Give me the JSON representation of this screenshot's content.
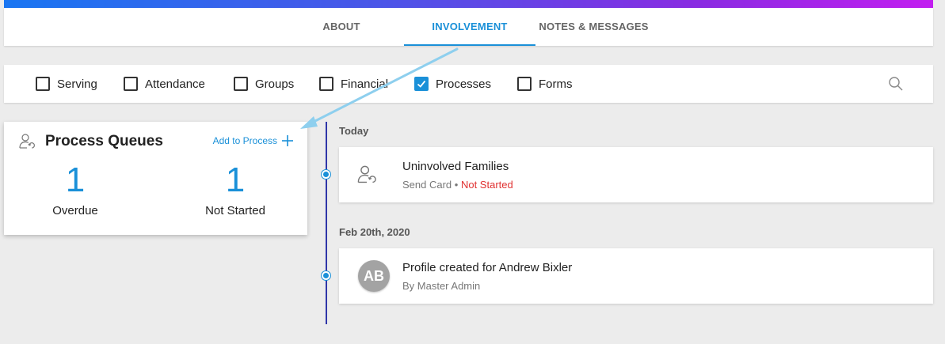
{
  "tabs": [
    {
      "label": "ABOUT",
      "active": false
    },
    {
      "label": "INVOLVEMENT",
      "active": true
    },
    {
      "label": "NOTES & MESSAGES",
      "active": false
    }
  ],
  "filters": [
    {
      "label": "Serving",
      "checked": false
    },
    {
      "label": "Attendance",
      "checked": false
    },
    {
      "label": "Groups",
      "checked": false
    },
    {
      "label": "Financial",
      "checked": false
    },
    {
      "label": "Processes",
      "checked": true
    },
    {
      "label": "Forms",
      "checked": false
    }
  ],
  "search": {
    "icon": "search-icon"
  },
  "process_queues": {
    "title": "Process Queues",
    "add_label": "Add to Process",
    "overdue": {
      "count": "1",
      "label": "Overdue"
    },
    "not_started": {
      "count": "1",
      "label": "Not Started"
    }
  },
  "timeline": {
    "groups": [
      {
        "date": "Today",
        "item": {
          "title": "Uninvolved Families",
          "subtitle": "Send Card",
          "separator": "•",
          "status": "Not Started"
        }
      },
      {
        "date": "Feb 20th, 2020",
        "item": {
          "avatar_initials": "AB",
          "title": "Profile created for Andrew Bixler",
          "subtitle": "By Master Admin"
        }
      }
    ]
  },
  "colors": {
    "accent": "#1a90d8",
    "status_red": "#e03131",
    "timeline": "#2f36a8",
    "annotation_arrow": "#8ecfee"
  }
}
